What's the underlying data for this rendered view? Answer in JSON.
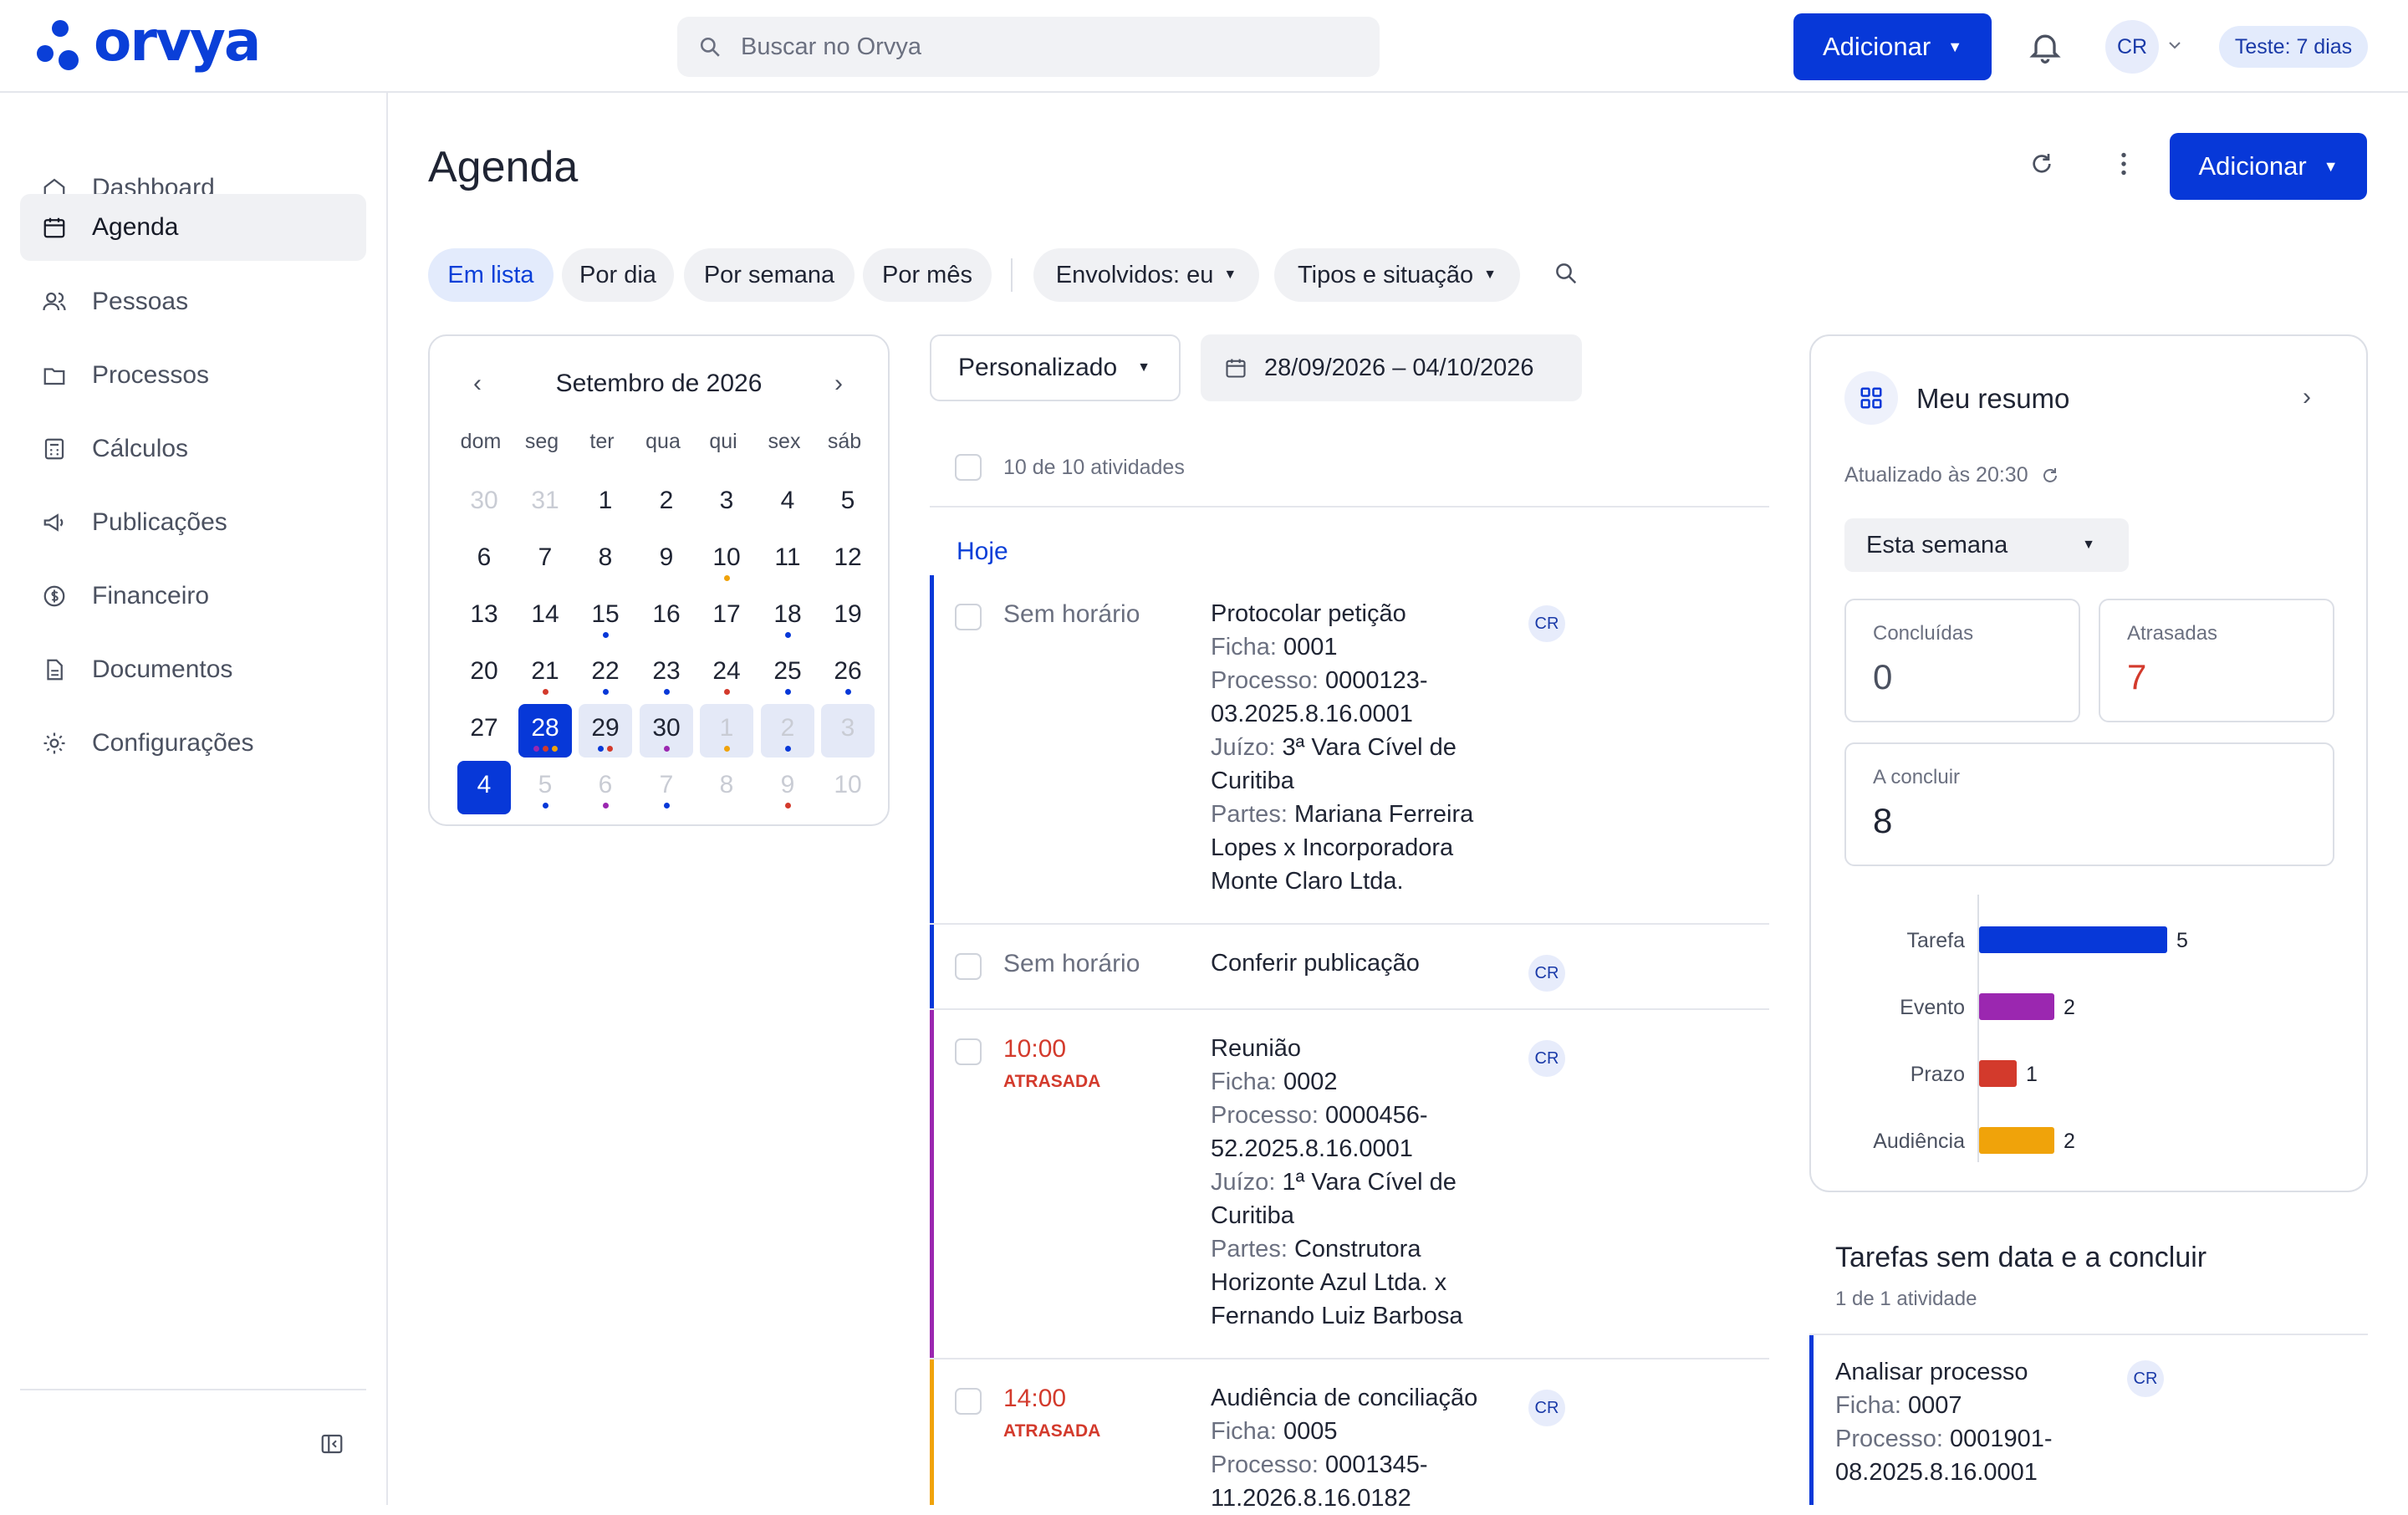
{
  "app": {
    "brand": "orvya"
  },
  "header": {
    "search_placeholder": "Buscar no Orvya",
    "add_label": "Adicionar",
    "avatar": "CR",
    "trial": "Teste: 7 dias"
  },
  "sidebar": {
    "items": [
      {
        "label": "Dashboard",
        "icon": "home-icon"
      },
      {
        "label": "Agenda",
        "icon": "calendar-icon",
        "active": true
      },
      {
        "label": "Pessoas",
        "icon": "people-icon"
      },
      {
        "label": "Processos",
        "icon": "folder-icon"
      },
      {
        "label": "Cálculos",
        "icon": "calculator-icon"
      },
      {
        "label": "Publicações",
        "icon": "megaphone-icon"
      },
      {
        "label": "Financeiro",
        "icon": "dollar-icon"
      },
      {
        "label": "Documentos",
        "icon": "document-icon"
      },
      {
        "label": "Configurações",
        "icon": "gear-icon"
      }
    ]
  },
  "page": {
    "title": "Agenda",
    "add_label": "Adicionar"
  },
  "views": {
    "list": "Em lista",
    "day": "Por dia",
    "week": "Por semana",
    "month": "Por mês"
  },
  "filters": {
    "involved": "Envolvidos: eu",
    "types": "Tipos e situação"
  },
  "calendar": {
    "title": "Setembro de 2026",
    "weekdays": [
      "dom",
      "seg",
      "ter",
      "qua",
      "qui",
      "sex",
      "sáb"
    ],
    "weeks": [
      [
        {
          "d": "30",
          "m": true
        },
        {
          "d": "31",
          "m": true
        },
        {
          "d": "1"
        },
        {
          "d": "2"
        },
        {
          "d": "3"
        },
        {
          "d": "4"
        },
        {
          "d": "5"
        }
      ],
      [
        {
          "d": "6"
        },
        {
          "d": "7"
        },
        {
          "d": "8"
        },
        {
          "d": "9"
        },
        {
          "d": "10",
          "dots": [
            "#f0a30a"
          ]
        },
        {
          "d": "11"
        },
        {
          "d": "12"
        }
      ],
      [
        {
          "d": "13"
        },
        {
          "d": "14"
        },
        {
          "d": "15",
          "dots": [
            "#0738d8"
          ]
        },
        {
          "d": "16"
        },
        {
          "d": "17"
        },
        {
          "d": "18",
          "dots": [
            "#0738d8"
          ]
        },
        {
          "d": "19"
        }
      ],
      [
        {
          "d": "20"
        },
        {
          "d": "21",
          "dots": [
            "#d33a2c"
          ]
        },
        {
          "d": "22",
          "dots": [
            "#0738d8"
          ]
        },
        {
          "d": "23",
          "dots": [
            "#0738d8"
          ]
        },
        {
          "d": "24",
          "dots": [
            "#d33a2c"
          ]
        },
        {
          "d": "25",
          "dots": [
            "#0738d8"
          ]
        },
        {
          "d": "26",
          "dots": [
            "#0738d8"
          ]
        }
      ],
      [
        {
          "d": "27"
        },
        {
          "d": "28",
          "sel": true,
          "dots": [
            "#9b27b0",
            "#d33a2c",
            "#f0a30a"
          ]
        },
        {
          "d": "29",
          "range": true,
          "dots": [
            "#0738d8",
            "#d33a2c"
          ]
        },
        {
          "d": "30",
          "range": true,
          "dots": [
            "#9b27b0"
          ]
        },
        {
          "d": "1",
          "m": true,
          "range": true,
          "dots": [
            "#f0a30a"
          ]
        },
        {
          "d": "2",
          "m": true,
          "range": true,
          "dots": [
            "#0738d8"
          ]
        },
        {
          "d": "3",
          "m": true,
          "range": true
        }
      ],
      [
        {
          "d": "4",
          "sel": true
        },
        {
          "d": "5",
          "m": true,
          "dots": [
            "#0738d8"
          ]
        },
        {
          "d": "6",
          "m": true,
          "dots": [
            "#9b27b0"
          ]
        },
        {
          "d": "7",
          "m": true,
          "dots": [
            "#0738d8"
          ]
        },
        {
          "d": "8",
          "m": true
        },
        {
          "d": "9",
          "m": true,
          "dots": [
            "#d33a2c"
          ]
        },
        {
          "d": "10",
          "m": true
        }
      ]
    ]
  },
  "period": {
    "mode": "Personalizado",
    "range": "28/09/2026 – 04/10/2026"
  },
  "list": {
    "count": "10 de 10 atividades",
    "group": "Hoje",
    "labels": {
      "ficha": "Ficha:",
      "processo": "Processo:",
      "juizo": "Juízo:",
      "partes": "Partes:"
    },
    "activities": [
      {
        "time": "Sem horário",
        "late": "",
        "color": "#0738d8",
        "title": "Protocolar petição",
        "ficha": "0001",
        "processo": "0000123-03.2025.8.16.0001",
        "juizo": "3ª Vara Cível de Curitiba",
        "partes": "Mariana Ferreira Lopes x Incorporadora Monte Claro Ltda.",
        "assignee": "CR"
      },
      {
        "time": "Sem horário",
        "late": "",
        "color": "#0738d8",
        "title": "Conferir publicação",
        "assignee": "CR"
      },
      {
        "time": "10:00",
        "late": "ATRASADA",
        "color": "#9b27b0",
        "title": "Reunião",
        "ficha": "0002",
        "processo": "0000456-52.2025.8.16.0001",
        "juizo": "1ª Vara Cível de Curitiba",
        "partes": "Construtora Horizonte Azul Ltda. x Fernando Luiz Barbosa",
        "assignee": "CR"
      },
      {
        "time": "14:00",
        "late": "ATRASADA",
        "color": "#f0a30a",
        "title": "Audiência de conciliação",
        "ficha": "0005",
        "processo": "0001345-11.2026.8.16.0182",
        "assignee": "CR"
      }
    ]
  },
  "summary": {
    "title": "Meu resumo",
    "updated": "Atualizado às 20:30",
    "period": "Esta semana",
    "stats": {
      "done_label": "Concluídas",
      "done_value": "0",
      "late_label": "Atrasadas",
      "late_value": "7",
      "todo_label": "A concluir",
      "todo_value": "8"
    }
  },
  "chart_data": {
    "type": "bar",
    "orientation": "horizontal",
    "categories": [
      "Tarefa",
      "Evento",
      "Prazo",
      "Audiência"
    ],
    "values": [
      5,
      2,
      1,
      2
    ],
    "colors": [
      "#0738d8",
      "#9b27b0",
      "#d33a2c",
      "#f0a30a"
    ]
  },
  "undated": {
    "title": "Tarefas sem data e a concluir",
    "count": "1 de 1 atividade",
    "item": {
      "title": "Analisar processo",
      "ficha": "0007",
      "processo": "0001901-08.2025.8.16.0001",
      "assignee": "CR"
    }
  }
}
